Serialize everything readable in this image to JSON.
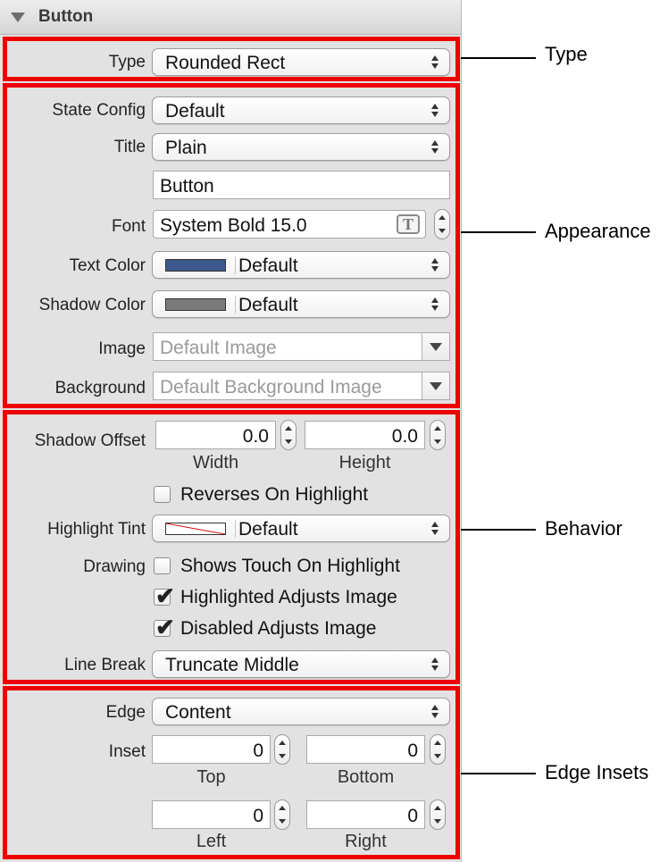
{
  "header": {
    "title": "Button"
  },
  "type_section": {
    "label": "Type",
    "value": "Rounded Rect"
  },
  "appearance": {
    "state_config": {
      "label": "State Config",
      "value": "Default"
    },
    "title_field": {
      "label": "Title",
      "value": "Plain"
    },
    "title_text": "Button",
    "font": {
      "label": "Font",
      "value": "System Bold 15.0",
      "icon_glyph": "T"
    },
    "text_color": {
      "label": "Text Color",
      "value": "Default",
      "swatch": "#3c5a8e"
    },
    "shadow_color": {
      "label": "Shadow Color",
      "value": "Default",
      "swatch": "#7a7a7a"
    },
    "image": {
      "label": "Image",
      "placeholder": "Default Image"
    },
    "background": {
      "label": "Background",
      "placeholder": "Default Background Image"
    }
  },
  "behavior": {
    "shadow_offset": {
      "label": "Shadow Offset",
      "width": "0.0",
      "height": "0.0",
      "width_label": "Width",
      "height_label": "Height"
    },
    "reverses": {
      "label": "Reverses On Highlight",
      "checked": false
    },
    "highlight_tint": {
      "label": "Highlight Tint",
      "value": "Default"
    },
    "drawing": {
      "label": "Drawing"
    },
    "shows_touch": {
      "label": "Shows Touch On Highlight",
      "checked": false
    },
    "highlighted_adjusts": {
      "label": "Highlighted Adjusts Image",
      "checked": true
    },
    "disabled_adjusts": {
      "label": "Disabled Adjusts Image",
      "checked": true
    },
    "line_break": {
      "label": "Line Break",
      "value": "Truncate Middle"
    }
  },
  "edge_insets": {
    "edge": {
      "label": "Edge",
      "value": "Content"
    },
    "inset_label": "Inset",
    "top": "0",
    "bottom": "0",
    "left": "0",
    "right": "0",
    "top_label": "Top",
    "bottom_label": "Bottom",
    "left_label": "Left",
    "right_label": "Right"
  },
  "callouts": {
    "type": "Type",
    "appearance": "Appearance",
    "behavior": "Behavior",
    "edge_insets": "Edge Insets"
  },
  "colors": {
    "highlight": "#ee0000",
    "check": "✔"
  }
}
